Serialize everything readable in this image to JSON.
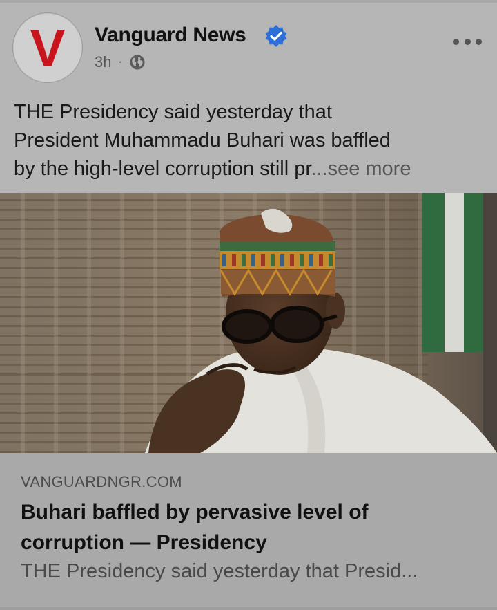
{
  "post": {
    "page_name": "Vanguard News",
    "time": "3h",
    "separator": "·",
    "audience_icon": "globe-icon",
    "verified_icon": "verified-badge-icon",
    "more_icon": "more-options-icon",
    "caption_lines": [
      "THE Presidency said yesterday that",
      "President Muhammadu Buhari was baffled",
      "by the high-level corruption still pr"
    ],
    "caption_ellipsis": "...",
    "see_more_label": "see more"
  },
  "avatar": {
    "letter": "V",
    "brand_color": "#c8141c"
  },
  "link_preview": {
    "domain": "VANGUARDNGR.COM",
    "title_line1": "Buhari baffled by pervasive level of",
    "title_line2": "corruption — Presidency",
    "description": "THE Presidency said yesterday that Presid..."
  },
  "colors": {
    "verified_blue": "#2d6fd6",
    "card_background": "#b6b6b6",
    "link_background": "#a9a9a9"
  }
}
